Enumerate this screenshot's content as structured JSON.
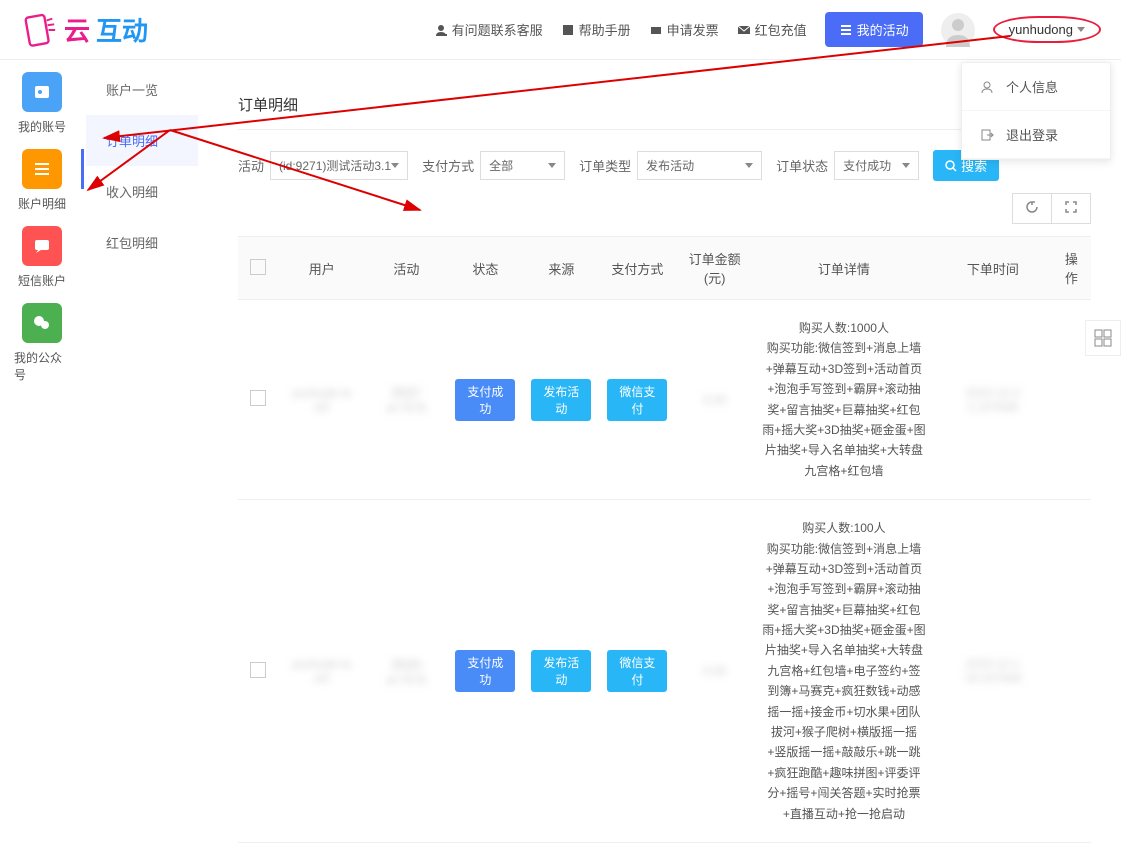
{
  "header": {
    "logo_text1": "云",
    "logo_text2": "互动",
    "nav": {
      "contact": "有问题联系客服",
      "help": "帮助手册",
      "invoice": "申请发票",
      "recharge": "红包充值",
      "my_activity": "我的活动"
    },
    "username": "yunhudong"
  },
  "user_menu": {
    "profile": "个人信息",
    "logout": "退出登录"
  },
  "rail": {
    "account": "我的账号",
    "details": "账户明细",
    "sms": "短信账户",
    "wechat": "我的公众号"
  },
  "sub_sidebar": {
    "overview": "账户一览",
    "orders": "订单明细",
    "income": "收入明细",
    "redpacket": "红包明细"
  },
  "main": {
    "title": "订单明细",
    "filters": {
      "activity_label": "活动",
      "activity_value": "(id:9271)测试活动3.1",
      "pay_method_label": "支付方式",
      "pay_method_value": "全部",
      "order_type_label": "订单类型",
      "order_type_value": "发布活动",
      "order_status_label": "订单状态",
      "order_status_value": "支付成功",
      "search_btn": "搜索"
    },
    "table": {
      "headers": {
        "user": "用户",
        "activity": "活动",
        "status": "状态",
        "source": "来源",
        "pay_method": "支付方式",
        "amount": "订单金额(元)",
        "details": "订单详情",
        "time": "下单时间",
        "action": "操作"
      },
      "rows": [
        {
          "user": "yunhude te st2",
          "activity": "测试7 id:7678",
          "status": "支付成功",
          "source": "发布活动",
          "pay_method": "微信支付",
          "amount": "0.00",
          "details": "购买人数:1000人\n购买功能:微信签到+消息上墙+弹幕互动+3D签到+活动首页+泡泡手写签到+霸屏+滚动抽奖+留言抽奖+巨幕抽奖+红包雨+摇大奖+3D抽奖+砸金蛋+图片抽奖+导入名单抽奖+大转盘九宫格+红包墙",
          "time": "2023-12-2 1:107648"
        },
        {
          "user": "yunhude te st2",
          "activity": "测试9 id:7678",
          "status": "支付成功",
          "source": "发布活动",
          "pay_method": "微信支付",
          "amount": "0.00",
          "details": "购买人数:100人\n购买功能:微信签到+消息上墙+弹幕互动+3D签到+活动首页+泡泡手写签到+霸屏+滚动抽奖+留言抽奖+巨幕抽奖+红包雨+摇大奖+3D抽奖+砸金蛋+图片抽奖+导入名单抽奖+大转盘九宫格+红包墙+电子签约+签到簿+马赛克+疯狂数钱+动感摇一摇+接金币+切水果+团队拔河+猴子爬树+横版摇一摇+竖版摇一摇+敲敲乐+跳一跳+疯狂跑酷+趣味拼图+评委评分+摇号+闯关答题+实时抢票+直播互动+抢一抢启动",
          "time": "2023-12-1 16:107648"
        }
      ]
    }
  },
  "colors": {
    "blue_icon": "#4aa3f7",
    "orange_icon": "#ff9800",
    "red_icon": "#ff5252",
    "green_icon": "#4caf50"
  }
}
